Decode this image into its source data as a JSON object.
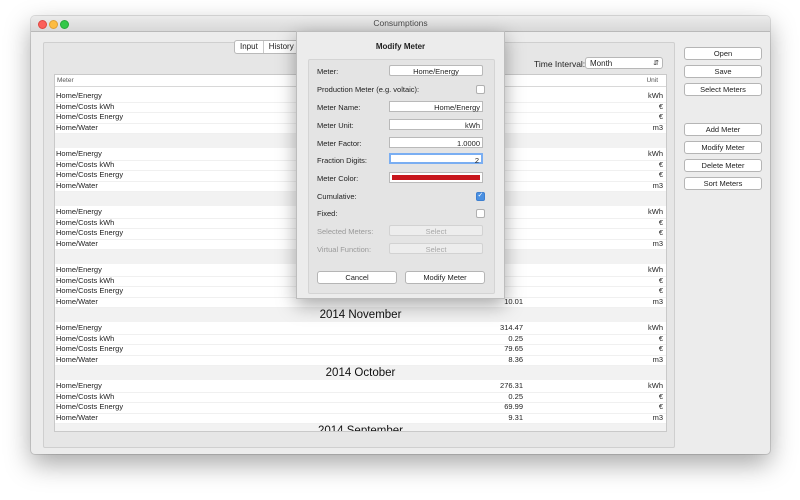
{
  "window": {
    "title": "Consumptions"
  },
  "tabs": [
    "Input",
    "History"
  ],
  "time_interval": {
    "label": "Time Interval:",
    "value": "Month"
  },
  "table": {
    "columns": {
      "meter": "Meter",
      "unit": "Unit"
    },
    "groups": [
      {
        "title": "",
        "rows": [
          {
            "name": "Home/Energy",
            "value": "",
            "unit": "kWh"
          },
          {
            "name": "Home/Costs kWh",
            "value": "",
            "unit": "€"
          },
          {
            "name": "Home/Costs Energy",
            "value": "",
            "unit": "€"
          },
          {
            "name": "Home/Water",
            "value": "",
            "unit": "m3"
          }
        ]
      },
      {
        "title": "",
        "rows": [
          {
            "name": "Home/Energy",
            "value": "",
            "unit": "kWh"
          },
          {
            "name": "Home/Costs kWh",
            "value": "",
            "unit": "€"
          },
          {
            "name": "Home/Costs Energy",
            "value": "",
            "unit": "€"
          },
          {
            "name": "Home/Water",
            "value": "",
            "unit": "m3"
          }
        ]
      },
      {
        "title": "",
        "rows": [
          {
            "name": "Home/Energy",
            "value": "",
            "unit": "kWh"
          },
          {
            "name": "Home/Costs kWh",
            "value": "",
            "unit": "€"
          },
          {
            "name": "Home/Costs Energy",
            "value": "",
            "unit": "€"
          },
          {
            "name": "Home/Water",
            "value": "",
            "unit": "m3"
          }
        ]
      },
      {
        "title": "",
        "rows": [
          {
            "name": "Home/Energy",
            "value": "",
            "unit": "kWh"
          },
          {
            "name": "Home/Costs kWh",
            "value": "",
            "unit": "€"
          },
          {
            "name": "Home/Costs Energy",
            "value": "",
            "unit": "€"
          },
          {
            "name": "Home/Water",
            "value": "10.01",
            "unit": "m3"
          }
        ]
      },
      {
        "title": "2014 November",
        "rows": [
          {
            "name": "Home/Energy",
            "value": "314.47",
            "unit": "kWh"
          },
          {
            "name": "Home/Costs kWh",
            "value": "0.25",
            "unit": "€"
          },
          {
            "name": "Home/Costs Energy",
            "value": "79.65",
            "unit": "€"
          },
          {
            "name": "Home/Water",
            "value": "8.36",
            "unit": "m3"
          }
        ]
      },
      {
        "title": "2014 October",
        "rows": [
          {
            "name": "Home/Energy",
            "value": "276.31",
            "unit": "kWh"
          },
          {
            "name": "Home/Costs kWh",
            "value": "0.25",
            "unit": "€"
          },
          {
            "name": "Home/Costs Energy",
            "value": "69.99",
            "unit": "€"
          },
          {
            "name": "Home/Water",
            "value": "9.31",
            "unit": "m3"
          }
        ]
      },
      {
        "title": "2014 September",
        "rows": []
      }
    ]
  },
  "sidebar_buttons": {
    "open": "Open",
    "save": "Save",
    "select_meters": "Select Meters",
    "add_meter": "Add Meter",
    "modify_meter": "Modify Meter",
    "delete_meter": "Delete Meter",
    "sort_meters": "Sort Meters"
  },
  "dialog": {
    "title": "Modify Meter",
    "meter": {
      "label": "Meter:",
      "value": "Home/Energy"
    },
    "production": {
      "label": "Production Meter (e.g. voltaic):",
      "checked": false
    },
    "meter_name": {
      "label": "Meter Name:",
      "value": "Home/Energy"
    },
    "meter_unit": {
      "label": "Meter Unit:",
      "value": "kWh"
    },
    "meter_factor": {
      "label": "Meter Factor:",
      "value": "1.0000"
    },
    "fraction_digits": {
      "label": "Fraction Digits:",
      "value": "2"
    },
    "meter_color": {
      "label": "Meter Color:",
      "value": "#c8161d"
    },
    "cumulative": {
      "label": "Cumulative:",
      "checked": true
    },
    "fixed": {
      "label": "Fixed:",
      "checked": false
    },
    "selected_meters": {
      "label": "Selected Meters:",
      "button": "Select"
    },
    "virtual_function": {
      "label": "Virtual Function:",
      "button": "Select"
    },
    "cancel": "Cancel",
    "submit": "Modify Meter"
  }
}
